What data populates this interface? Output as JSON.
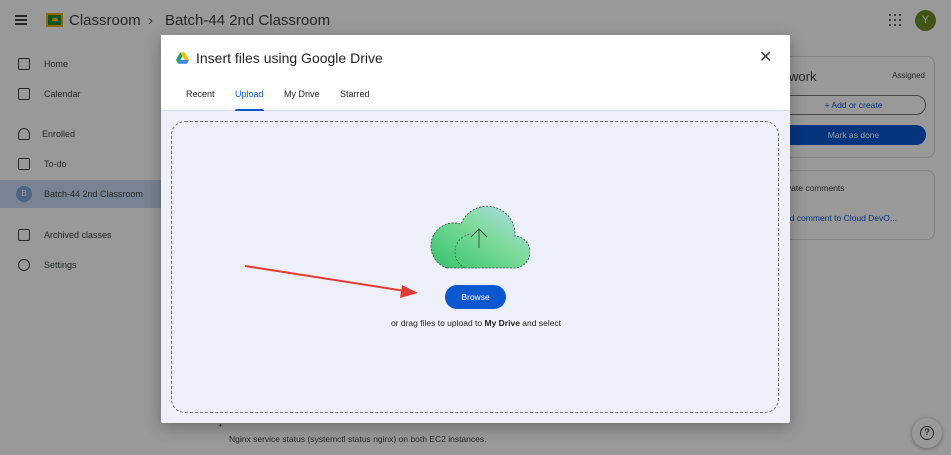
{
  "header": {
    "app_name": "Classroom",
    "breadcrumb_separator": "›",
    "class_name": "Batch-44 2nd Classroom",
    "avatar_letter": "Y"
  },
  "sidebar": {
    "items": [
      {
        "label": "Home",
        "icon": "home-icon"
      },
      {
        "label": "Calendar",
        "icon": "calendar-icon"
      },
      {
        "label": "Enrolled",
        "icon": "enrolled-icon"
      },
      {
        "label": "To-do",
        "icon": "todo-icon"
      },
      {
        "label": "Batch-44 2nd Classroom",
        "icon": "class-avatar",
        "badge": "B",
        "active": true
      },
      {
        "label": "Archived classes",
        "icon": "archive-icon"
      },
      {
        "label": "Settings",
        "icon": "settings-icon"
      }
    ]
  },
  "work_card": {
    "title": "work",
    "status": "Assigned",
    "add_label": "+ Add or create",
    "done_label": "Mark as done"
  },
  "comments_card": {
    "title": "ivate comments",
    "link": "dd comment to Cloud DevO..."
  },
  "page_footer": {
    "bullet": "•",
    "text": "Nginx service status (systemctl status nginx) on both EC2 instances."
  },
  "dialog": {
    "title": "Insert files using Google Drive",
    "close_label": "✕",
    "tabs": [
      "Recent",
      "Upload",
      "My Drive",
      "Starred"
    ],
    "active_tab": "Upload",
    "browse_label": "Browse",
    "hint_prefix": "or drag files to upload to ",
    "hint_bold": "My Drive",
    "hint_suffix": " and select"
  },
  "help_label": "?",
  "colors": {
    "accent": "#0b57d0",
    "dialog_bg": "#eef0f9",
    "annotation_arrow": "#e53935"
  }
}
